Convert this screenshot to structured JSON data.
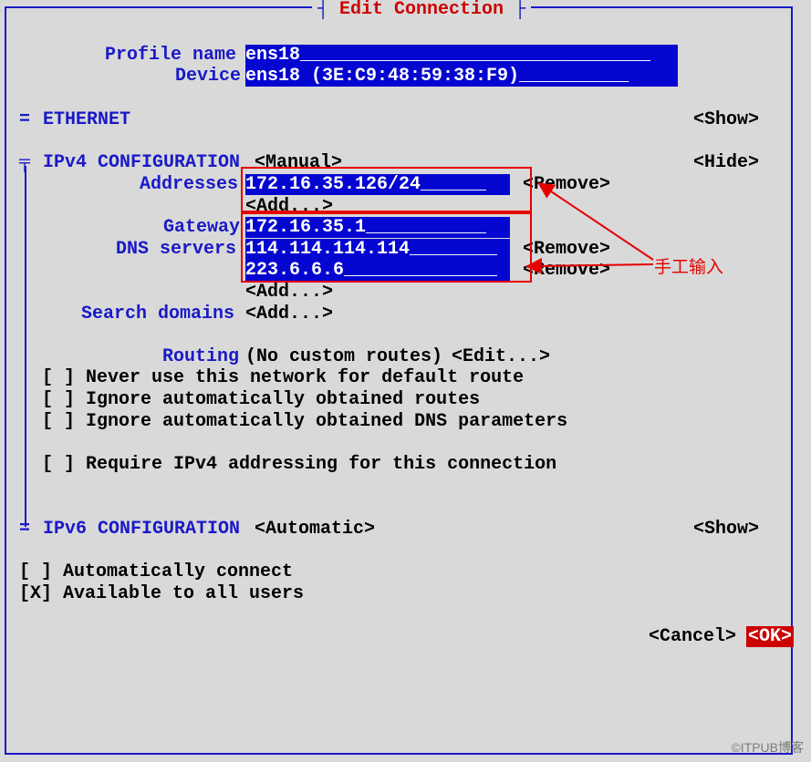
{
  "title": "Edit Connection",
  "profile": {
    "label": "Profile name",
    "value": "ens18"
  },
  "device": {
    "label": "Device",
    "value": "ens18 (3E:C9:48:59:38:F9)"
  },
  "ethernet": {
    "prefix": "=",
    "label": "ETHERNET",
    "show": "<Show>"
  },
  "ipv4": {
    "heading": "IPv4 CONFIGURATION",
    "mode": "<Manual>",
    "hide": "<Hide>",
    "addresses_label": "Addresses",
    "addresses": [
      {
        "value": "172.16.35.126/24",
        "remove": "<Remove>"
      }
    ],
    "addresses_add": "<Add...>",
    "gateway_label": "Gateway",
    "gateway": "172.16.35.1",
    "dns_label": "DNS servers",
    "dns": [
      {
        "value": "114.114.114.114",
        "remove": "<Remove>"
      },
      {
        "value": "223.6.6.6",
        "remove": "<Remove>"
      }
    ],
    "dns_add": "<Add...>",
    "search_label": "Search domains",
    "search_add": "<Add...>",
    "routing_label": "Routing",
    "routing_value": "(No custom routes)",
    "routing_edit": "<Edit...>",
    "checks": {
      "never_default": "Never use this network for default route",
      "ignore_routes": "Ignore automatically obtained routes",
      "ignore_dns": "Ignore automatically obtained DNS parameters",
      "require_ipv4": "Require IPv4 addressing for this connection"
    }
  },
  "ipv6": {
    "prefix": "=",
    "heading": "IPv6 CONFIGURATION",
    "mode": "<Automatic>",
    "show": "<Show>"
  },
  "auto_connect": "Automatically connect",
  "all_users": "Available to all users",
  "cancel": "<Cancel>",
  "ok": "<OK>",
  "annotation": "手工输入",
  "watermark": "©ITPUB博客",
  "underscore_fill": "_"
}
